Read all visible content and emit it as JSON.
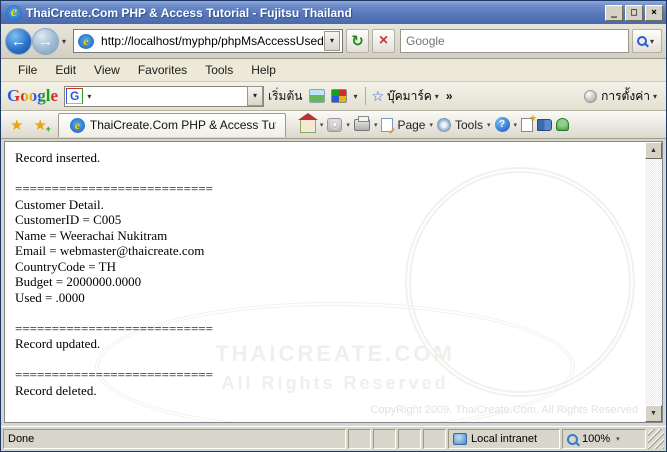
{
  "window": {
    "title": "ThaiCreate.Com PHP & Access Tutorial - Fujitsu Thailand",
    "minimize": "_",
    "maximize": "□",
    "close": "×"
  },
  "nav": {
    "back_arrow": "←",
    "forward_arrow": "→",
    "dropdown_arrow": "▾",
    "url": "http://localhost/myphp/phpMsAccessUsedFunction",
    "refresh_glyph": "↻",
    "stop_glyph": "×",
    "search_placeholder": "Google"
  },
  "menu": {
    "items": [
      "File",
      "Edit",
      "View",
      "Favorites",
      "Tools",
      "Help"
    ]
  },
  "google_toolbar": {
    "logo": "Google",
    "g_button": "G",
    "combo_arrow": "▾",
    "go_label": "เริ่มต้น",
    "bookmarks_star": "☆",
    "bookmarks_label": "บุ๊คมาร์ค",
    "overflow_chevron": "»",
    "settings_label": "การตั้งค่า"
  },
  "tab_bar": {
    "favorites_star": "★",
    "add_favorite_star": "★",
    "tab_title": "ThaiCreate.Com PHP & Access Tutorial",
    "feed_glyph": "⦿",
    "page_label": "Page",
    "tools_label": "Tools",
    "help_glyph": "?"
  },
  "content": {
    "lines": [
      "Record inserted.",
      "",
      "===========================",
      "Customer Detail.",
      "CustomerID = C005",
      "Name = Weerachai Nukitram",
      "Email = webmaster@thaicreate.com",
      "CountryCode = TH",
      "Budget = 2000000.0000",
      "Used = .0000",
      "",
      "===========================",
      "Record updated.",
      "",
      "===========================",
      "Record deleted."
    ],
    "watermark_line1": "THAICREATE.COM",
    "watermark_line2": "All Rights Reserved",
    "copyright": "CopyRight 2009. ThaiCreate.Com. All Rights Reserved"
  },
  "status": {
    "done": "Done",
    "zone": "Local intranet",
    "zoom": "100%"
  },
  "colors": {
    "titlebar_blue": "#5878ba",
    "toolbar_beige": "#ece9d8",
    "accent_blue": "#2a5bd7"
  }
}
